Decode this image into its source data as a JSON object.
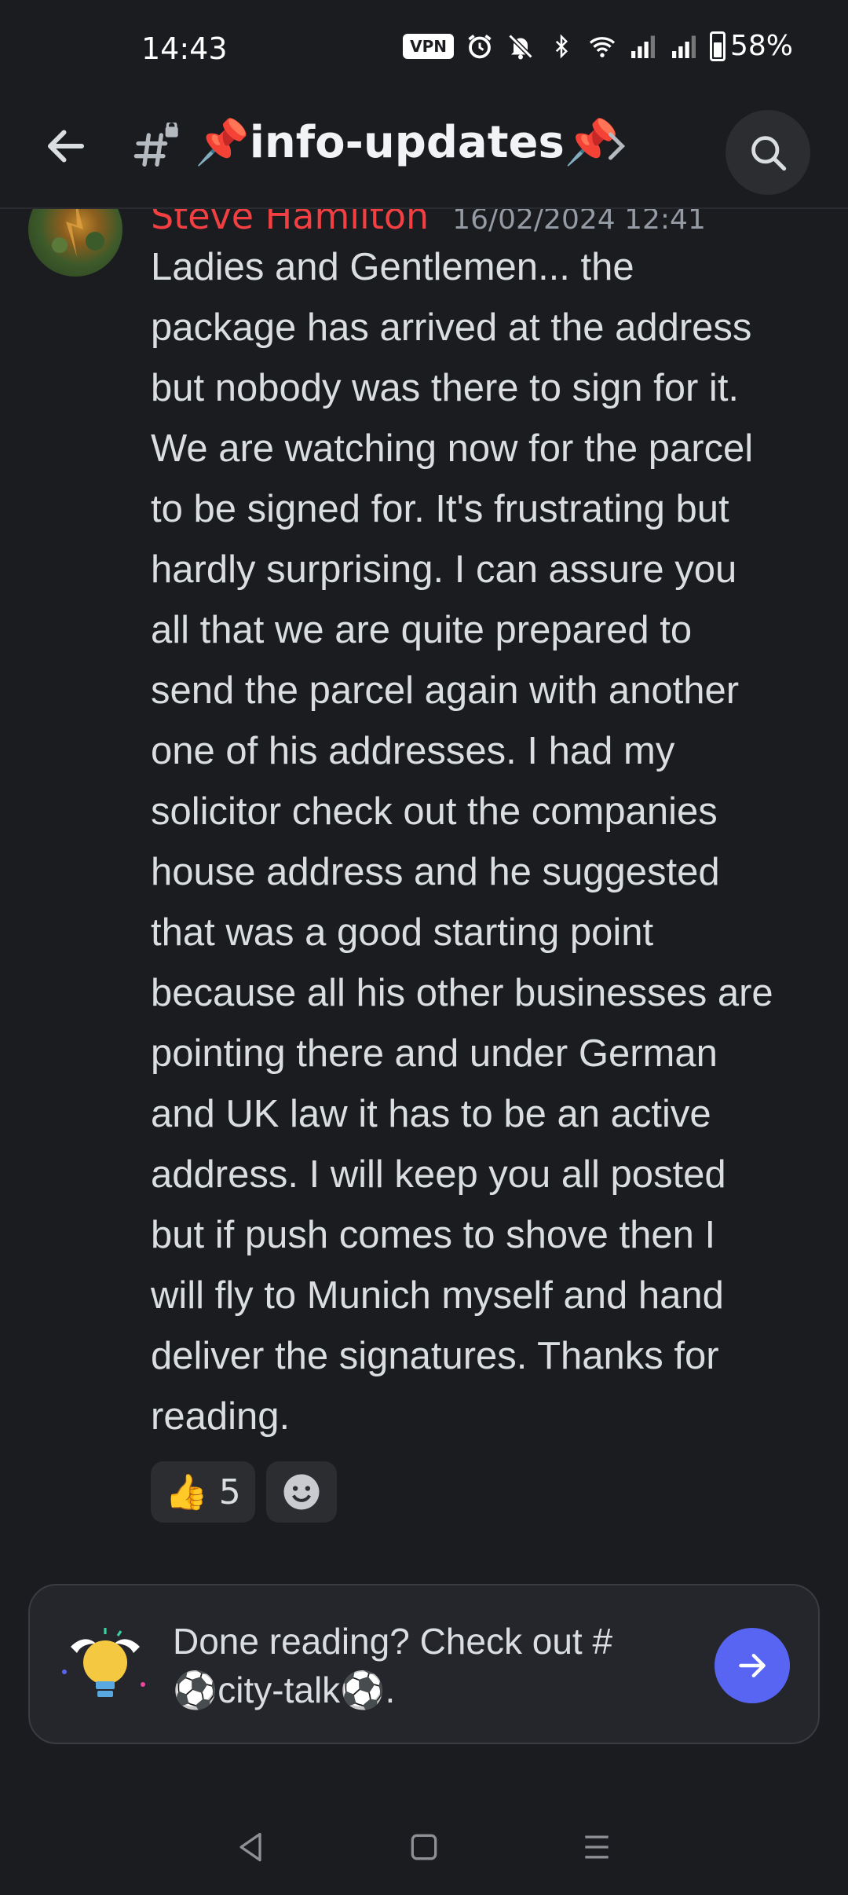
{
  "status_bar": {
    "time": "14:43",
    "vpn": "VPN",
    "battery": "58%",
    "battery_level": 0.58
  },
  "header": {
    "channel_name": "📌info-updates📌"
  },
  "message": {
    "author": "Steve Hamilton",
    "author_color": "#f23f42",
    "timestamp": "16/02/2024 12:41",
    "lines": [
      "Ladies and Gentlemen... the",
      "package has arrived at the address",
      "but nobody was there to sign for it.",
      "We are watching now for the parcel",
      "to be signed for. It's frustrating but",
      "hardly surprising. I can assure you",
      "all that we are quite prepared to",
      "send the parcel again with another",
      "one of his addresses. I had my",
      "solicitor check out the companies",
      "house address and he suggested",
      "that was a good starting point",
      "because all his other businesses are",
      "pointing there and under German",
      "and UK law it has to be an active",
      "address. I will keep you all posted",
      "but if push comes to shove then I",
      "will fly to Munich myself and hand",
      "deliver the signatures. Thanks for",
      "reading."
    ],
    "reactions": [
      {
        "emoji": "👍",
        "count": "5"
      }
    ]
  },
  "prompt_card": {
    "line1": "Done reading? Check out #",
    "line2": "⚽city-talk⚽."
  },
  "colors": {
    "background": "#1b1c20",
    "accent": "#5865f2"
  }
}
